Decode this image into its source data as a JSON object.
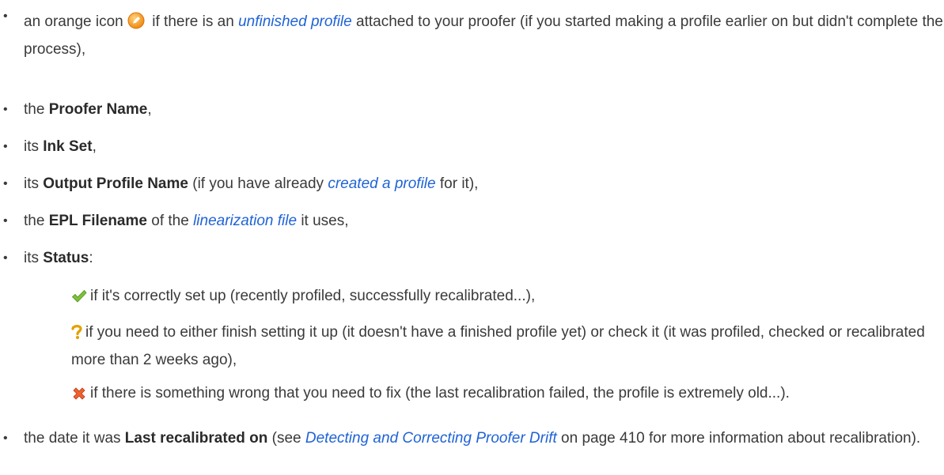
{
  "items": [
    {
      "pre": "an orange icon ",
      "icon": "orange-warning-icon",
      "mid": " if there is an ",
      "link": "unfinished profile",
      "post": " attached to your proofer (if you started making a profile earlier on but didn't complete the process),"
    },
    {
      "pre": "the ",
      "bold": "Proofer Name",
      "post": ","
    },
    {
      "pre": "its ",
      "bold": "Ink Set",
      "post": ","
    },
    {
      "pre": "its ",
      "bold": "Output Profile Name",
      "mid": " (if you have already ",
      "link": "created a profile",
      "post": " for it),"
    },
    {
      "pre": "the ",
      "bold": "EPL Filename",
      "mid": " of the ",
      "link": "linearization file",
      "post": " it uses,"
    },
    {
      "pre": "its ",
      "bold": "Status",
      "post": ":"
    }
  ],
  "status": [
    {
      "icon": "green-check-icon",
      "text": "if it's correctly set up (recently profiled, successfully recalibrated...),"
    },
    {
      "icon": "question-mark-icon",
      "text": "if you need to either finish setting it up (it doesn't have a finished profile yet) or check it (it was profiled, checked or recalibrated more than 2 weeks ago),"
    },
    {
      "icon": "red-x-icon",
      "text": "if there is something wrong that you need to fix (the last recalibration failed, the profile is extremely old...)."
    }
  ],
  "last": {
    "pre": "the date it was ",
    "bold": "Last recalibrated on",
    "mid": " (see ",
    "link": "Detecting and Correcting Proofer Drift",
    "post": " on page 410 for more information about recalibration)."
  },
  "bullet_char": "•"
}
